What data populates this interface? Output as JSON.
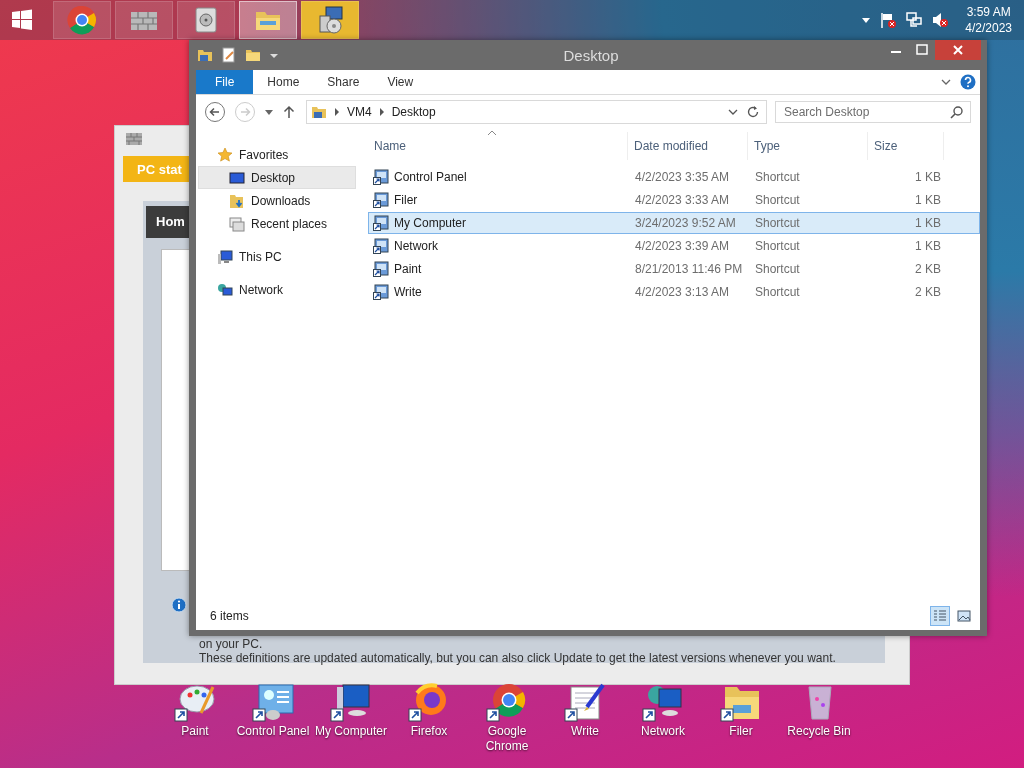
{
  "taskbar": {
    "apps": [
      {
        "kind": "chrome",
        "selected": false,
        "flashing": false
      },
      {
        "kind": "wall",
        "selected": false,
        "flashing": false
      },
      {
        "kind": "disk",
        "selected": false,
        "flashing": false
      },
      {
        "kind": "folder",
        "selected": true,
        "flashing": false
      },
      {
        "kind": "setup",
        "selected": false,
        "flashing": true
      }
    ],
    "clock": {
      "time": "3:59 AM",
      "date": "4/2/2023"
    }
  },
  "background_window": {
    "header": "PC stat",
    "tab": "Hom",
    "lines": [
      "on your PC.",
      "These definitions are updated automatically, but you can also click Update to get the latest versions whenever you want."
    ]
  },
  "explorer": {
    "title": "Desktop",
    "ribbon_tabs": [
      {
        "label": "File",
        "selected": true
      },
      {
        "label": "Home",
        "selected": false
      },
      {
        "label": "Share",
        "selected": false
      },
      {
        "label": "View",
        "selected": false
      }
    ],
    "address": [
      "VM4",
      "Desktop"
    ],
    "search": {
      "placeholder": "Search Desktop"
    },
    "nav": [
      {
        "label": "Favorites",
        "kind": "star",
        "selected": false,
        "children": [
          {
            "label": "Desktop",
            "kind": "desktop",
            "selected": true
          },
          {
            "label": "Downloads",
            "kind": "downloads",
            "selected": false
          },
          {
            "label": "Recent places",
            "kind": "recent",
            "selected": false
          }
        ]
      },
      {
        "label": "This PC",
        "kind": "pc",
        "selected": false
      },
      {
        "label": "Network",
        "kind": "network",
        "selected": false
      }
    ],
    "columns": [
      "Name",
      "Date modified",
      "Type",
      "Size"
    ],
    "rows": [
      {
        "name": "Control Panel",
        "date": "4/2/2023 3:35 AM",
        "type": "Shortcut",
        "size": "1 KB",
        "selected": false
      },
      {
        "name": "Filer",
        "date": "4/2/2023 3:33 AM",
        "type": "Shortcut",
        "size": "1 KB",
        "selected": false
      },
      {
        "name": "My Computer",
        "date": "3/24/2023 9:52 AM",
        "type": "Shortcut",
        "size": "1 KB",
        "selected": true
      },
      {
        "name": "Network",
        "date": "4/2/2023 3:39 AM",
        "type": "Shortcut",
        "size": "1 KB",
        "selected": false
      },
      {
        "name": "Paint",
        "date": "8/21/2013 11:46 PM",
        "type": "Shortcut",
        "size": "2 KB",
        "selected": false
      },
      {
        "name": "Write",
        "date": "4/2/2023 3:13 AM",
        "type": "Shortcut",
        "size": "2 KB",
        "selected": false
      }
    ],
    "status": "6 items",
    "views": [
      {
        "kind": "details",
        "selected": true
      },
      {
        "kind": "large",
        "selected": false
      }
    ]
  },
  "desktop_icons": [
    {
      "label": "Paint",
      "kind": "paint"
    },
    {
      "label": "Control Panel",
      "kind": "control-panel"
    },
    {
      "label": "My Computer",
      "kind": "computer"
    },
    {
      "label": "Firefox",
      "kind": "firefox"
    },
    {
      "label": "Google Chrome",
      "kind": "chrome"
    },
    {
      "label": "Write",
      "kind": "write"
    },
    {
      "label": "Network",
      "kind": "network"
    },
    {
      "label": "Filer",
      "kind": "folder"
    },
    {
      "label": "Recycle Bin",
      "kind": "recycle"
    }
  ]
}
